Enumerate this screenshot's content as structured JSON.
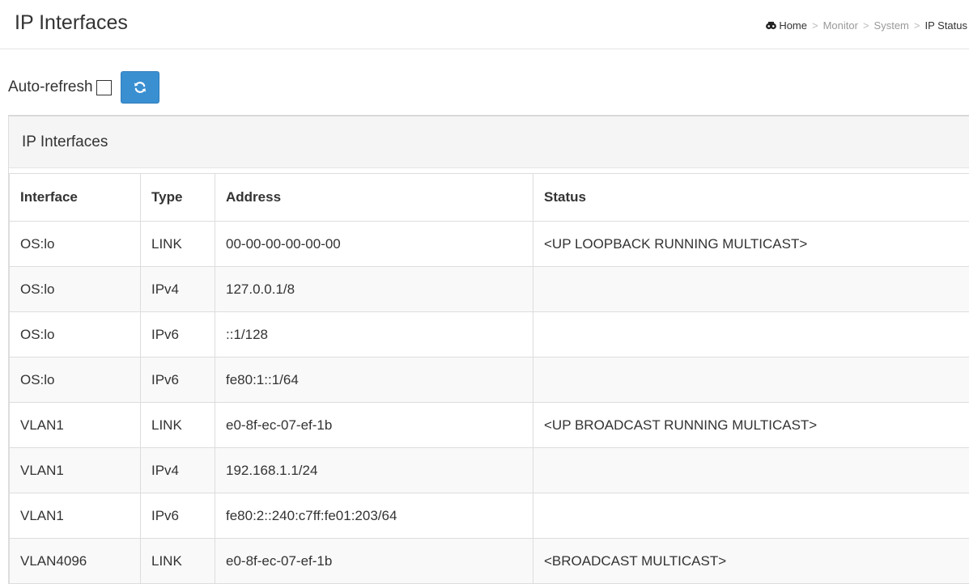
{
  "header": {
    "title": "IP Interfaces",
    "breadcrumb": {
      "home": "Home",
      "monitor": "Monitor",
      "system": "System",
      "current": "IP Status",
      "separator": ">"
    }
  },
  "toolbar": {
    "auto_refresh_label": "Auto-refresh",
    "auto_refresh_checked": false,
    "refresh_icon": "refresh-icon"
  },
  "panel": {
    "title": "IP Interfaces"
  },
  "table": {
    "columns": [
      "Interface",
      "Type",
      "Address",
      "Status"
    ],
    "rows": [
      {
        "interface": "OS:lo",
        "type": "LINK",
        "address": "00-00-00-00-00-00",
        "status": "<UP LOOPBACK RUNNING MULTICAST>"
      },
      {
        "interface": "OS:lo",
        "type": "IPv4",
        "address": "127.0.0.1/8",
        "status": ""
      },
      {
        "interface": "OS:lo",
        "type": "IPv6",
        "address": "::1/128",
        "status": ""
      },
      {
        "interface": "OS:lo",
        "type": "IPv6",
        "address": "fe80:1::1/64",
        "status": ""
      },
      {
        "interface": "VLAN1",
        "type": "LINK",
        "address": "e0-8f-ec-07-ef-1b",
        "status": "<UP BROADCAST RUNNING MULTICAST>"
      },
      {
        "interface": "VLAN1",
        "type": "IPv4",
        "address": "192.168.1.1/24",
        "status": ""
      },
      {
        "interface": "VLAN1",
        "type": "IPv6",
        "address": "fe80:2::240:c7ff:fe01:203/64",
        "status": ""
      },
      {
        "interface": "VLAN4096",
        "type": "LINK",
        "address": "e0-8f-ec-07-ef-1b",
        "status": "<BROADCAST MULTICAST>"
      }
    ]
  },
  "colors": {
    "refresh_button": "#3a8fd1",
    "panel_heading_bg": "#f5f5f5",
    "border": "#dddddd"
  }
}
